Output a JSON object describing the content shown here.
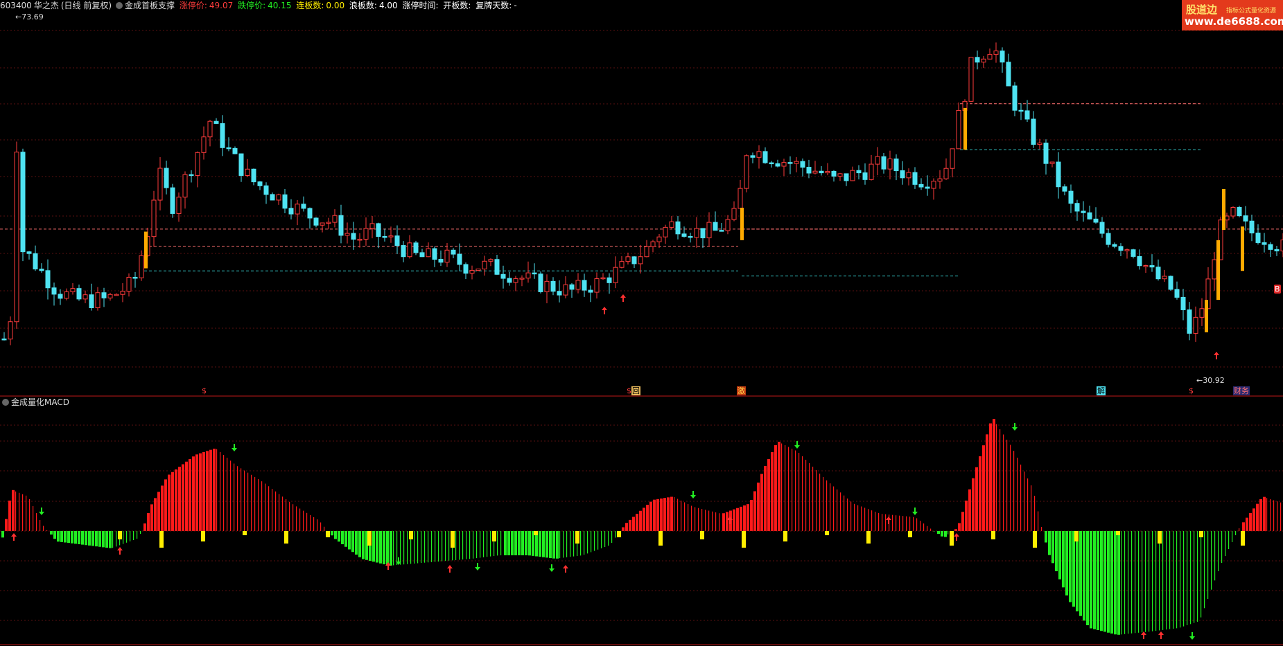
{
  "header": {
    "code": "603400",
    "name": "华之杰",
    "period": "(日线 前复权)",
    "indicator": "金成首板支撑",
    "limit_up_label": "涨停价:",
    "limit_up": "49.07",
    "limit_down_label": "跌停价:",
    "limit_down": "40.15",
    "streak_label": "连板数:",
    "streak": "0.00",
    "wave_label": "浪板数:",
    "wave": "4.00",
    "limit_time_label": "涨停时间:",
    "open_count_label": "开板数:",
    "resume_label": "复牌天数:",
    "resume": "-"
  },
  "sub_indicator": "金成量化MACD",
  "price_labels": {
    "high": "73.69",
    "low": "30.92"
  },
  "markers": [
    "$",
    "$",
    "回",
    "激",
    "解",
    "$",
    "财务",
    "B"
  ],
  "logo": {
    "brand": "股道边",
    "tagline": "指标公式量化资源",
    "url": "www.de6688.com"
  },
  "colors": {
    "up": "#ff3c3c",
    "down": "#4fe3f2",
    "macd_up": "#ff1a1a",
    "macd_down": "#22ee22",
    "vol_bar": "#ffee00",
    "support": "#ff7070",
    "resist": "#33c0c0"
  },
  "chart_data": {
    "type": "candlestick",
    "ylim": [
      30.92,
      73.69
    ],
    "support_lines": [
      {
        "value": 46.3,
        "color": "support"
      },
      {
        "value": 43.4,
        "color": "resist"
      },
      {
        "value": 63.0,
        "color": "support"
      },
      {
        "value": 57.6,
        "color": "resist"
      },
      {
        "value": 48.3,
        "color": "support"
      },
      {
        "value": 42.8,
        "color": "resist"
      }
    ]
  }
}
